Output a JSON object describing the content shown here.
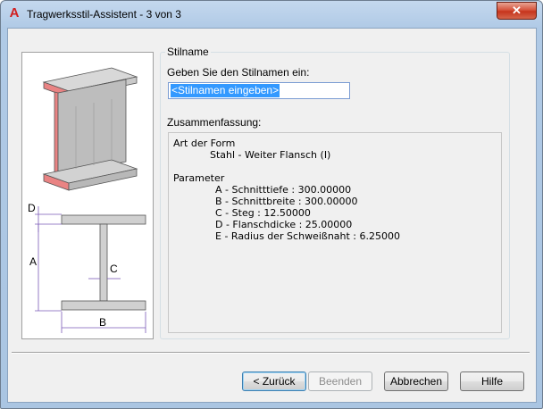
{
  "window": {
    "title": "Tragwerksstil-Assistent - 3 von 3",
    "close_glyph": "✕",
    "app_icon_glyph": "A",
    "accent_color": "#d11f1f"
  },
  "illustration": {
    "dim_labels": [
      "D",
      "A",
      "C",
      "B"
    ],
    "flange_color": "#e07a7a",
    "dimension_color": "#7a5ab8"
  },
  "style_name": {
    "group_label": "Stilname",
    "prompt": "Geben Sie den Stilnamen ein:",
    "input_value": "<Stilnamen eingeben>"
  },
  "summary": {
    "label": "Zusammenfassung:",
    "form_heading": "Art der Form",
    "form_value": "Stahl - Weiter Flansch (I)",
    "parameters_heading": "Parameter",
    "parameters": [
      "A - Schnitttiefe : 300.00000",
      "B - Schnittbreite : 300.00000",
      "C - Steg : 12.50000",
      "D - Flanschdicke : 25.00000",
      "E - Radius der Schweißnaht : 6.25000"
    ]
  },
  "buttons": {
    "back": "< Zurück",
    "finish": "Beenden",
    "cancel": "Abbrechen",
    "help": "Hilfe"
  }
}
